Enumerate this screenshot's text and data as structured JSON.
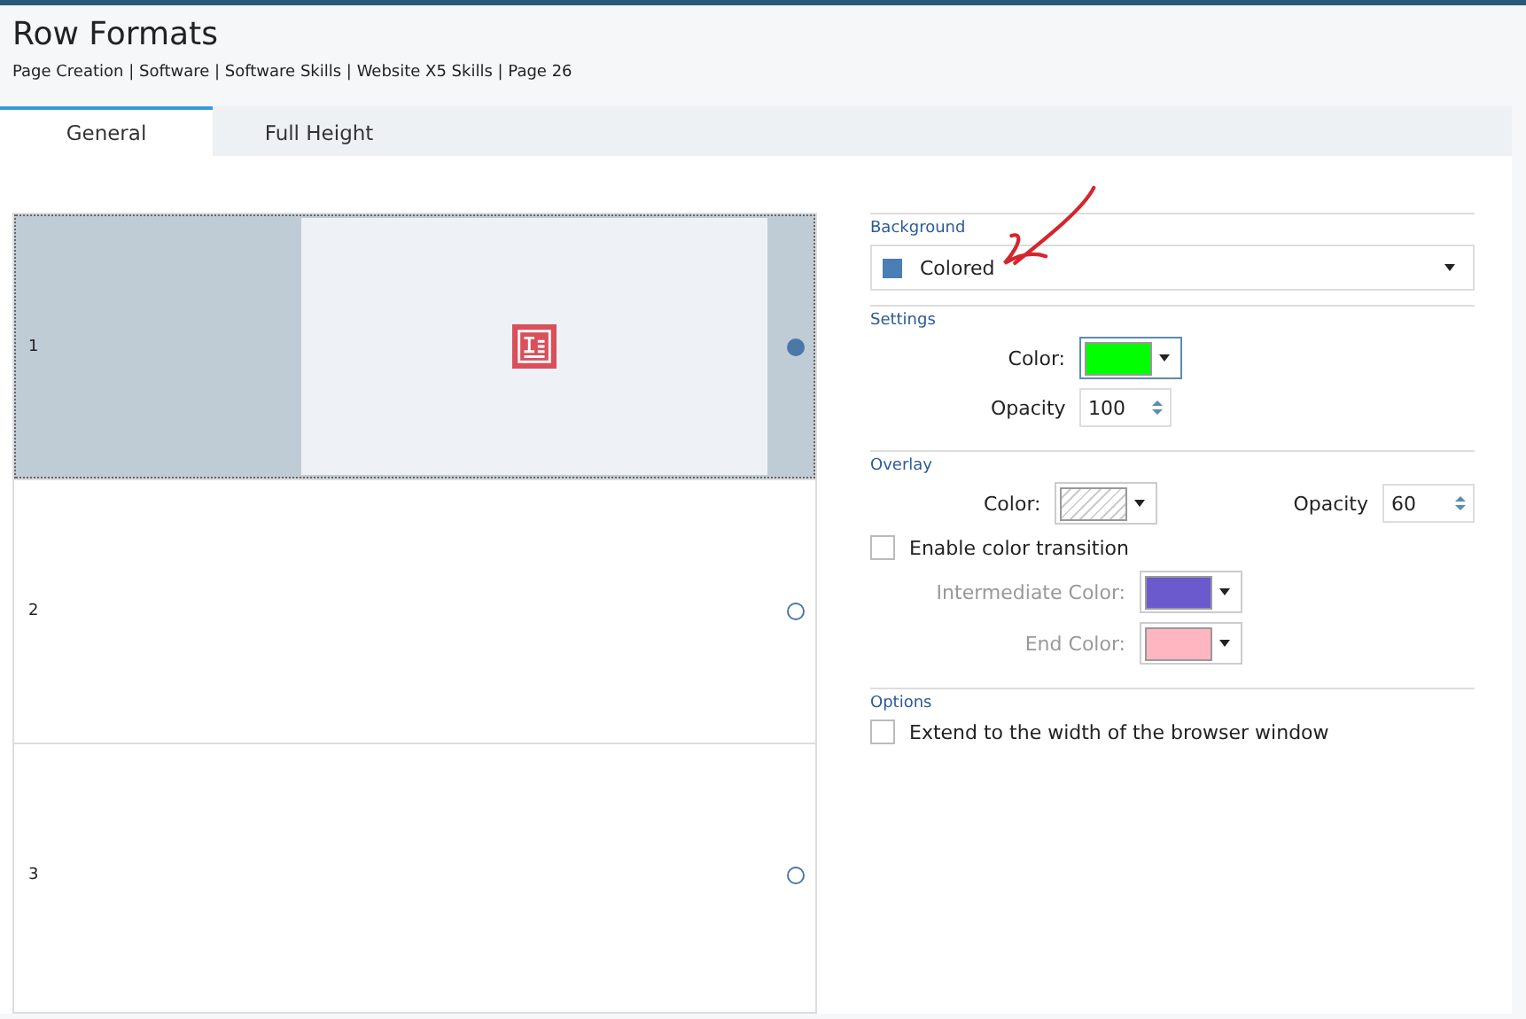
{
  "title": "Row Formats",
  "breadcrumb": "Page Creation | Software | Software Skills | Website X5 Skills | Page 26",
  "tabs": [
    {
      "label": "General",
      "selected": true
    },
    {
      "label": "Full Height",
      "selected": false
    }
  ],
  "rows": [
    {
      "label": "1",
      "selected": true
    },
    {
      "label": "2",
      "selected": false
    },
    {
      "label": "3",
      "selected": false
    }
  ],
  "background": {
    "heading": "Background",
    "value": "Colored",
    "color": "#4a7eb5"
  },
  "settings": {
    "heading": "Settings",
    "color_label": "Color:",
    "color": "#00ff00",
    "opacity_label": "Opacity",
    "opacity": "100"
  },
  "overlay": {
    "heading": "Overlay",
    "color_label": "Color:",
    "opacity_label": "Opacity",
    "opacity": "60",
    "transition": {
      "label": "Enable color transition",
      "checked": false
    },
    "intermediate": {
      "label": "Intermediate Color:",
      "color": "#6a5acd",
      "disabled": true
    },
    "end": {
      "label": "End Color:",
      "color": "#ffb6c1",
      "disabled": true
    }
  },
  "options": {
    "heading": "Options",
    "extend": {
      "label": "Extend to the width of the browser window",
      "checked": false
    }
  }
}
